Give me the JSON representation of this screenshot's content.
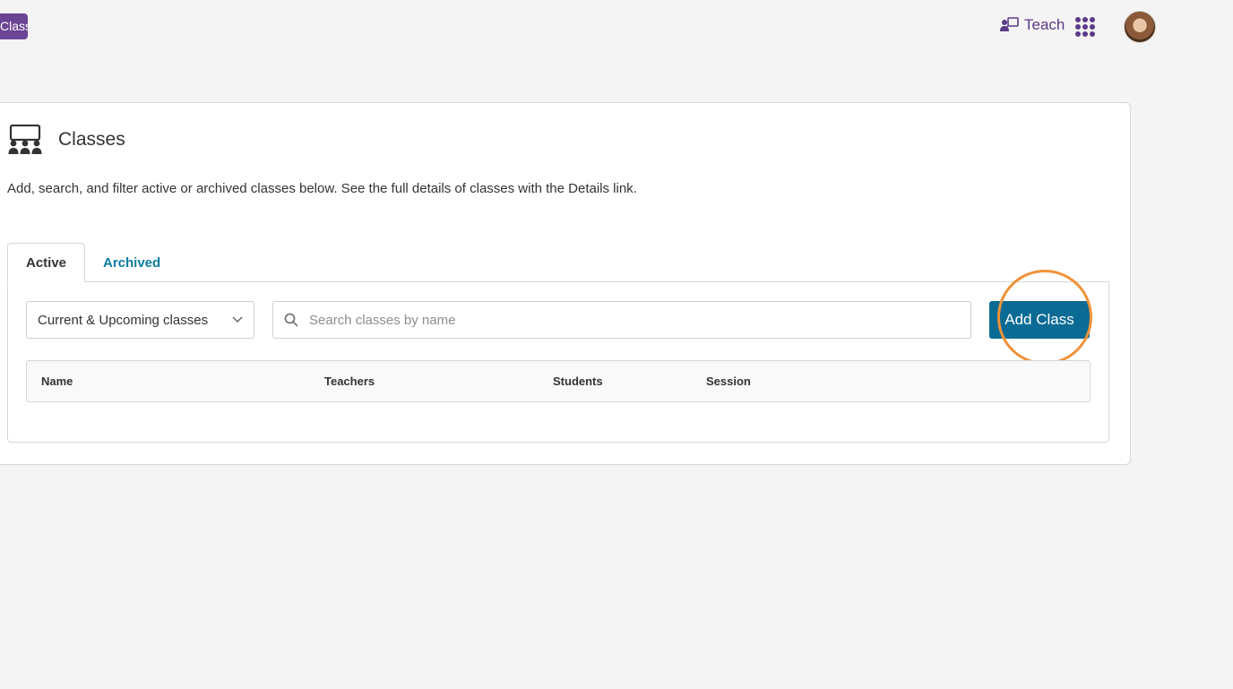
{
  "top_bar": {
    "badge_label": "Class",
    "teach_label": "Teach",
    "accent_color": "#5b3a88"
  },
  "classes": {
    "title": "Classes",
    "description": "Add, search, and filter active or archived classes below. See the full details of classes with the Details link.",
    "tabs": [
      {
        "label": "Active",
        "active": true
      },
      {
        "label": "Archived",
        "active": false
      }
    ],
    "filter": {
      "selected": "Current & Upcoming classes"
    },
    "search": {
      "placeholder": "Search classes by name",
      "value": ""
    },
    "add_button_label": "Add Class",
    "table": {
      "columns": [
        "Name",
        "Teachers",
        "Students",
        "Session"
      ],
      "rows": []
    }
  },
  "colors": {
    "primary_button": "#0b6b94",
    "tab_link": "#0b7ca0",
    "highlight": "#f0923a"
  }
}
